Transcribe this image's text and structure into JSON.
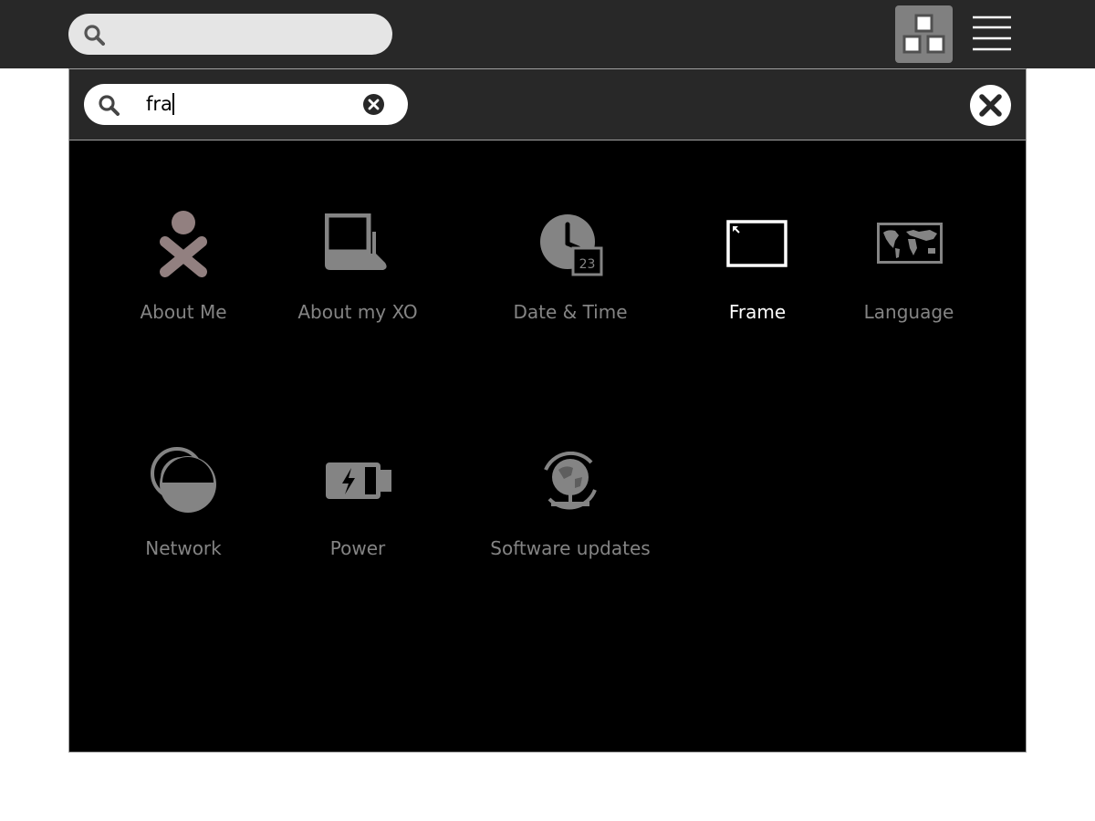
{
  "topbar": {
    "search": {
      "placeholder": ""
    },
    "icons": [
      "search-icon",
      "view-toggle-icon",
      "menu-icon"
    ]
  },
  "control_panel": {
    "search": {
      "value": "fra",
      "icons": [
        "search-icon",
        "clear-icon"
      ]
    },
    "close_icon": "close-icon",
    "items": [
      {
        "label": "About Me",
        "icon": "xo-person-icon",
        "highlighted": false,
        "color": "#928080"
      },
      {
        "label": "About my XO",
        "icon": "laptop-icon",
        "highlighted": false,
        "color": "#848484"
      },
      {
        "label": "Date & Time",
        "icon": "clock-calendar-icon",
        "highlighted": false,
        "color": "#848484",
        "badge": "23"
      },
      {
        "label": "Frame",
        "icon": "frame-icon",
        "highlighted": true,
        "color": "#ffffff"
      },
      {
        "label": "Language",
        "icon": "world-map-icon",
        "highlighted": false,
        "color": "#848484"
      },
      {
        "label": "Network",
        "icon": "network-icon",
        "highlighted": false,
        "color": "#848484"
      },
      {
        "label": "Power",
        "icon": "battery-icon",
        "highlighted": false,
        "color": "#848484"
      },
      {
        "label": "Software updates",
        "icon": "software-update-icon",
        "highlighted": false,
        "color": "#848484"
      }
    ]
  },
  "colors": {
    "toolbar_bg": "#282828",
    "panel_bg": "#000000",
    "inactive_label": "#848484",
    "active_label": "#ffffff"
  }
}
